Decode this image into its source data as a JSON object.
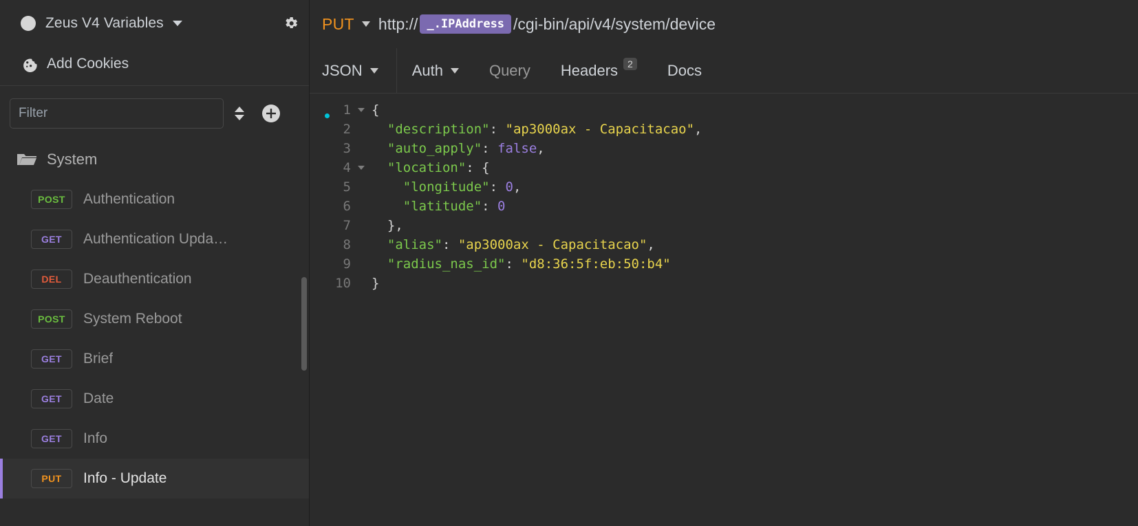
{
  "sidebar": {
    "workspace": {
      "name": "Zeus V4 Variables",
      "dropdown_icon": "chevron-down-icon",
      "settings_icon": "gear-icon"
    },
    "cookies": {
      "label": "Add Cookies",
      "icon": "cookie-icon"
    },
    "filter": {
      "placeholder": "Filter",
      "value": "",
      "sort_icon": "sort-icon",
      "add_icon": "plus-circle-icon"
    },
    "folder": {
      "label": "System",
      "icon": "folder-open-icon"
    },
    "requests": [
      {
        "method": "POST",
        "label": "Authentication",
        "selected": false
      },
      {
        "method": "GET",
        "label": "Authentication Upda…",
        "selected": false
      },
      {
        "method": "DEL",
        "label": "Deauthentication",
        "selected": false
      },
      {
        "method": "POST",
        "label": "System Reboot",
        "selected": false
      },
      {
        "method": "GET",
        "label": "Brief",
        "selected": false
      },
      {
        "method": "GET",
        "label": "Date",
        "selected": false
      },
      {
        "method": "GET",
        "label": "Info",
        "selected": false
      },
      {
        "method": "PUT",
        "label": "Info - Update",
        "selected": true
      }
    ],
    "method_colors": {
      "POST": "#6bbf3f",
      "GET": "#9b7fe0",
      "DEL": "#e35c3c",
      "PUT": "#f0921f"
    },
    "selection_accent": "#9b7fe0"
  },
  "request": {
    "method": "PUT",
    "url_prefix": "http://",
    "url_variable": "_.IPAddress",
    "url_path": "/cgi-bin/api/v4/system/device",
    "variable_chip_color": "#7b6ab0"
  },
  "tabs": {
    "body_type": "JSON",
    "items": [
      {
        "label": "Auth",
        "has_dropdown": true,
        "badge": "",
        "active": false
      },
      {
        "label": "Query",
        "has_dropdown": false,
        "badge": "",
        "active": false
      },
      {
        "label": "Headers",
        "has_dropdown": false,
        "badge": "2",
        "active": false
      },
      {
        "label": "Docs",
        "has_dropdown": false,
        "badge": "",
        "active": false
      }
    ]
  },
  "editor": {
    "line_numbers": [
      "1",
      "2",
      "3",
      "4",
      "5",
      "6",
      "7",
      "8",
      "9",
      "10"
    ],
    "fold_lines": [
      1,
      4
    ],
    "cursor_line": 1,
    "lines": [
      [
        {
          "t": "{",
          "c": "p"
        }
      ],
      [
        {
          "t": "  ",
          "c": "p"
        },
        {
          "t": "\"description\"",
          "c": "k"
        },
        {
          "t": ": ",
          "c": "p"
        },
        {
          "t": "\"ap3000ax - Capacitacao\"",
          "c": "s"
        },
        {
          "t": ",",
          "c": "p"
        }
      ],
      [
        {
          "t": "  ",
          "c": "p"
        },
        {
          "t": "\"auto_apply\"",
          "c": "k"
        },
        {
          "t": ": ",
          "c": "p"
        },
        {
          "t": "false",
          "c": "b"
        },
        {
          "t": ",",
          "c": "p"
        }
      ],
      [
        {
          "t": "  ",
          "c": "p"
        },
        {
          "t": "\"location\"",
          "c": "k"
        },
        {
          "t": ": ",
          "c": "p"
        },
        {
          "t": "{",
          "c": "p"
        }
      ],
      [
        {
          "t": "    ",
          "c": "p"
        },
        {
          "t": "\"longitude\"",
          "c": "k"
        },
        {
          "t": ": ",
          "c": "p"
        },
        {
          "t": "0",
          "c": "n"
        },
        {
          "t": ",",
          "c": "p"
        }
      ],
      [
        {
          "t": "    ",
          "c": "p"
        },
        {
          "t": "\"latitude\"",
          "c": "k"
        },
        {
          "t": ": ",
          "c": "p"
        },
        {
          "t": "0",
          "c": "n"
        }
      ],
      [
        {
          "t": "  ",
          "c": "p"
        },
        {
          "t": "},",
          "c": "p"
        }
      ],
      [
        {
          "t": "  ",
          "c": "p"
        },
        {
          "t": "\"alias\"",
          "c": "k"
        },
        {
          "t": ": ",
          "c": "p"
        },
        {
          "t": "\"ap3000ax - Capacitacao\"",
          "c": "s"
        },
        {
          "t": ",",
          "c": "p"
        }
      ],
      [
        {
          "t": "  ",
          "c": "p"
        },
        {
          "t": "\"radius_nas_id\"",
          "c": "k"
        },
        {
          "t": ": ",
          "c": "p"
        },
        {
          "t": "\"d8:36:5f:eb:50:b4\"",
          "c": "s"
        }
      ],
      [
        {
          "t": "}",
          "c": "p"
        }
      ]
    ]
  }
}
